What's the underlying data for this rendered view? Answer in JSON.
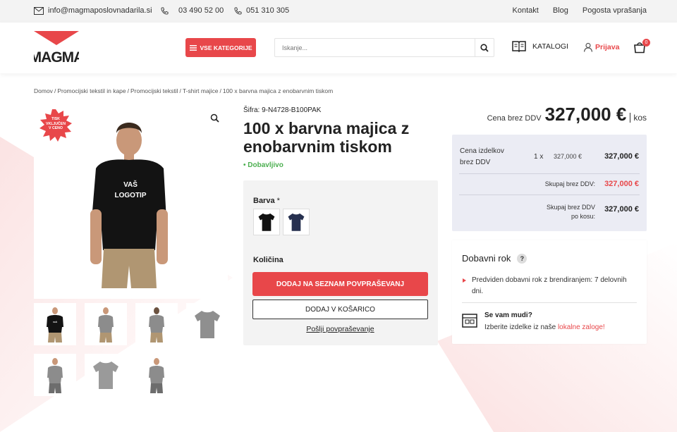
{
  "topbar": {
    "email": "info@magmaposlovnadarila.si",
    "phone1": "03 490 52 00",
    "phone2": "051 310 305",
    "links": [
      "Kontakt",
      "Blog",
      "Pogosta vprašanja"
    ]
  },
  "header": {
    "logo_text": "MAGMA",
    "categories_label": "VSE KATEGORIJE",
    "search_placeholder": "Iskanje...",
    "catalogs_label": "KATALOGI",
    "login_label": "Prijava",
    "cart_count": "0"
  },
  "breadcrumb": [
    "Domov",
    "Promocijski tekstil in kape",
    "Promocijski tekstil",
    "T-shirt majice",
    "100 x barvna majica z enobarvnim tiskom"
  ],
  "product": {
    "stamp_text": "TISK VKLJUČEN V CENO",
    "shirt_text_1": "VAŠ",
    "shirt_text_2": "LOGOTIP",
    "sku": "Šifra: 9-N4728-B100PAK",
    "title": "100 x barvna majica z enobarvnim tiskom",
    "stock": "Dobavljivo",
    "color_label": "Barva",
    "required_mark": "*",
    "colors": [
      "#111111",
      "#26304f"
    ],
    "quantity_label": "Količina",
    "add_inquiry_label": "DODAJ NA SEZNAM POVPRAŠEVANJ",
    "add_cart_label": "DODAJ V KOŠARICO",
    "send_inquiry_label": "Pošlji povpraševanje"
  },
  "pricing": {
    "price_label": "Cena brez DDV",
    "price_value": "327,000 €",
    "unit": "kos",
    "items_label": "Cena izdelkov brez DDV",
    "qty": "1 x",
    "unit_price": "327,000 €",
    "items_total": "327,000 €",
    "total_label": "Skupaj brez DDV:",
    "total_value": "327,000 €",
    "per_piece_label": "Skupaj brez DDV po kosu:",
    "per_piece_value": "327,000 €"
  },
  "delivery": {
    "title": "Dobavni rok",
    "help": "?",
    "bullet": "Predviden dobavni rok z brendiranjem: 7 delovnih dni.",
    "hurry_title": "Se vam mudi?",
    "hurry_text": "Izberite izdelke iz naše",
    "hurry_link": "lokalne zaloge!"
  },
  "colors": {
    "accent": "#e8474a",
    "success": "#4caf50",
    "summary_bg": "#ebecf4"
  }
}
